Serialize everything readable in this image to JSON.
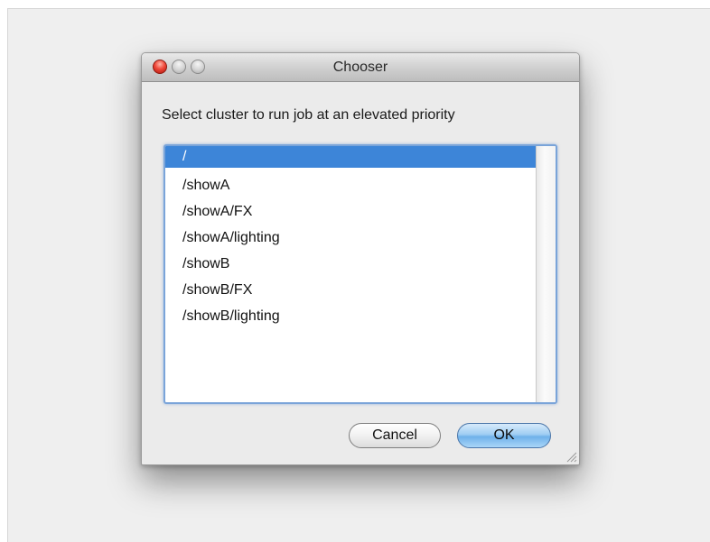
{
  "window": {
    "title": "Chooser"
  },
  "dialog": {
    "prompt": "Select cluster to run job at an elevated priority"
  },
  "list": {
    "items": [
      {
        "label": "/",
        "selected": true
      },
      {
        "label": "/showA",
        "selected": false
      },
      {
        "label": "/showA/FX",
        "selected": false
      },
      {
        "label": "/showA/lighting",
        "selected": false
      },
      {
        "label": "/showB",
        "selected": false
      },
      {
        "label": "/showB/FX",
        "selected": false
      },
      {
        "label": "/showB/lighting",
        "selected": false
      }
    ]
  },
  "buttons": {
    "cancel_label": "Cancel",
    "ok_label": "OK"
  },
  "icons": {
    "close": "close-icon",
    "minimize": "minimize-icon",
    "zoom": "zoom-icon",
    "resize": "resize-grip-icon"
  },
  "colors": {
    "selection": "#3d85d8",
    "focus_ring": "#7aa4d9",
    "close_button": "#f0483a",
    "default_button": "#6fb1ea"
  }
}
